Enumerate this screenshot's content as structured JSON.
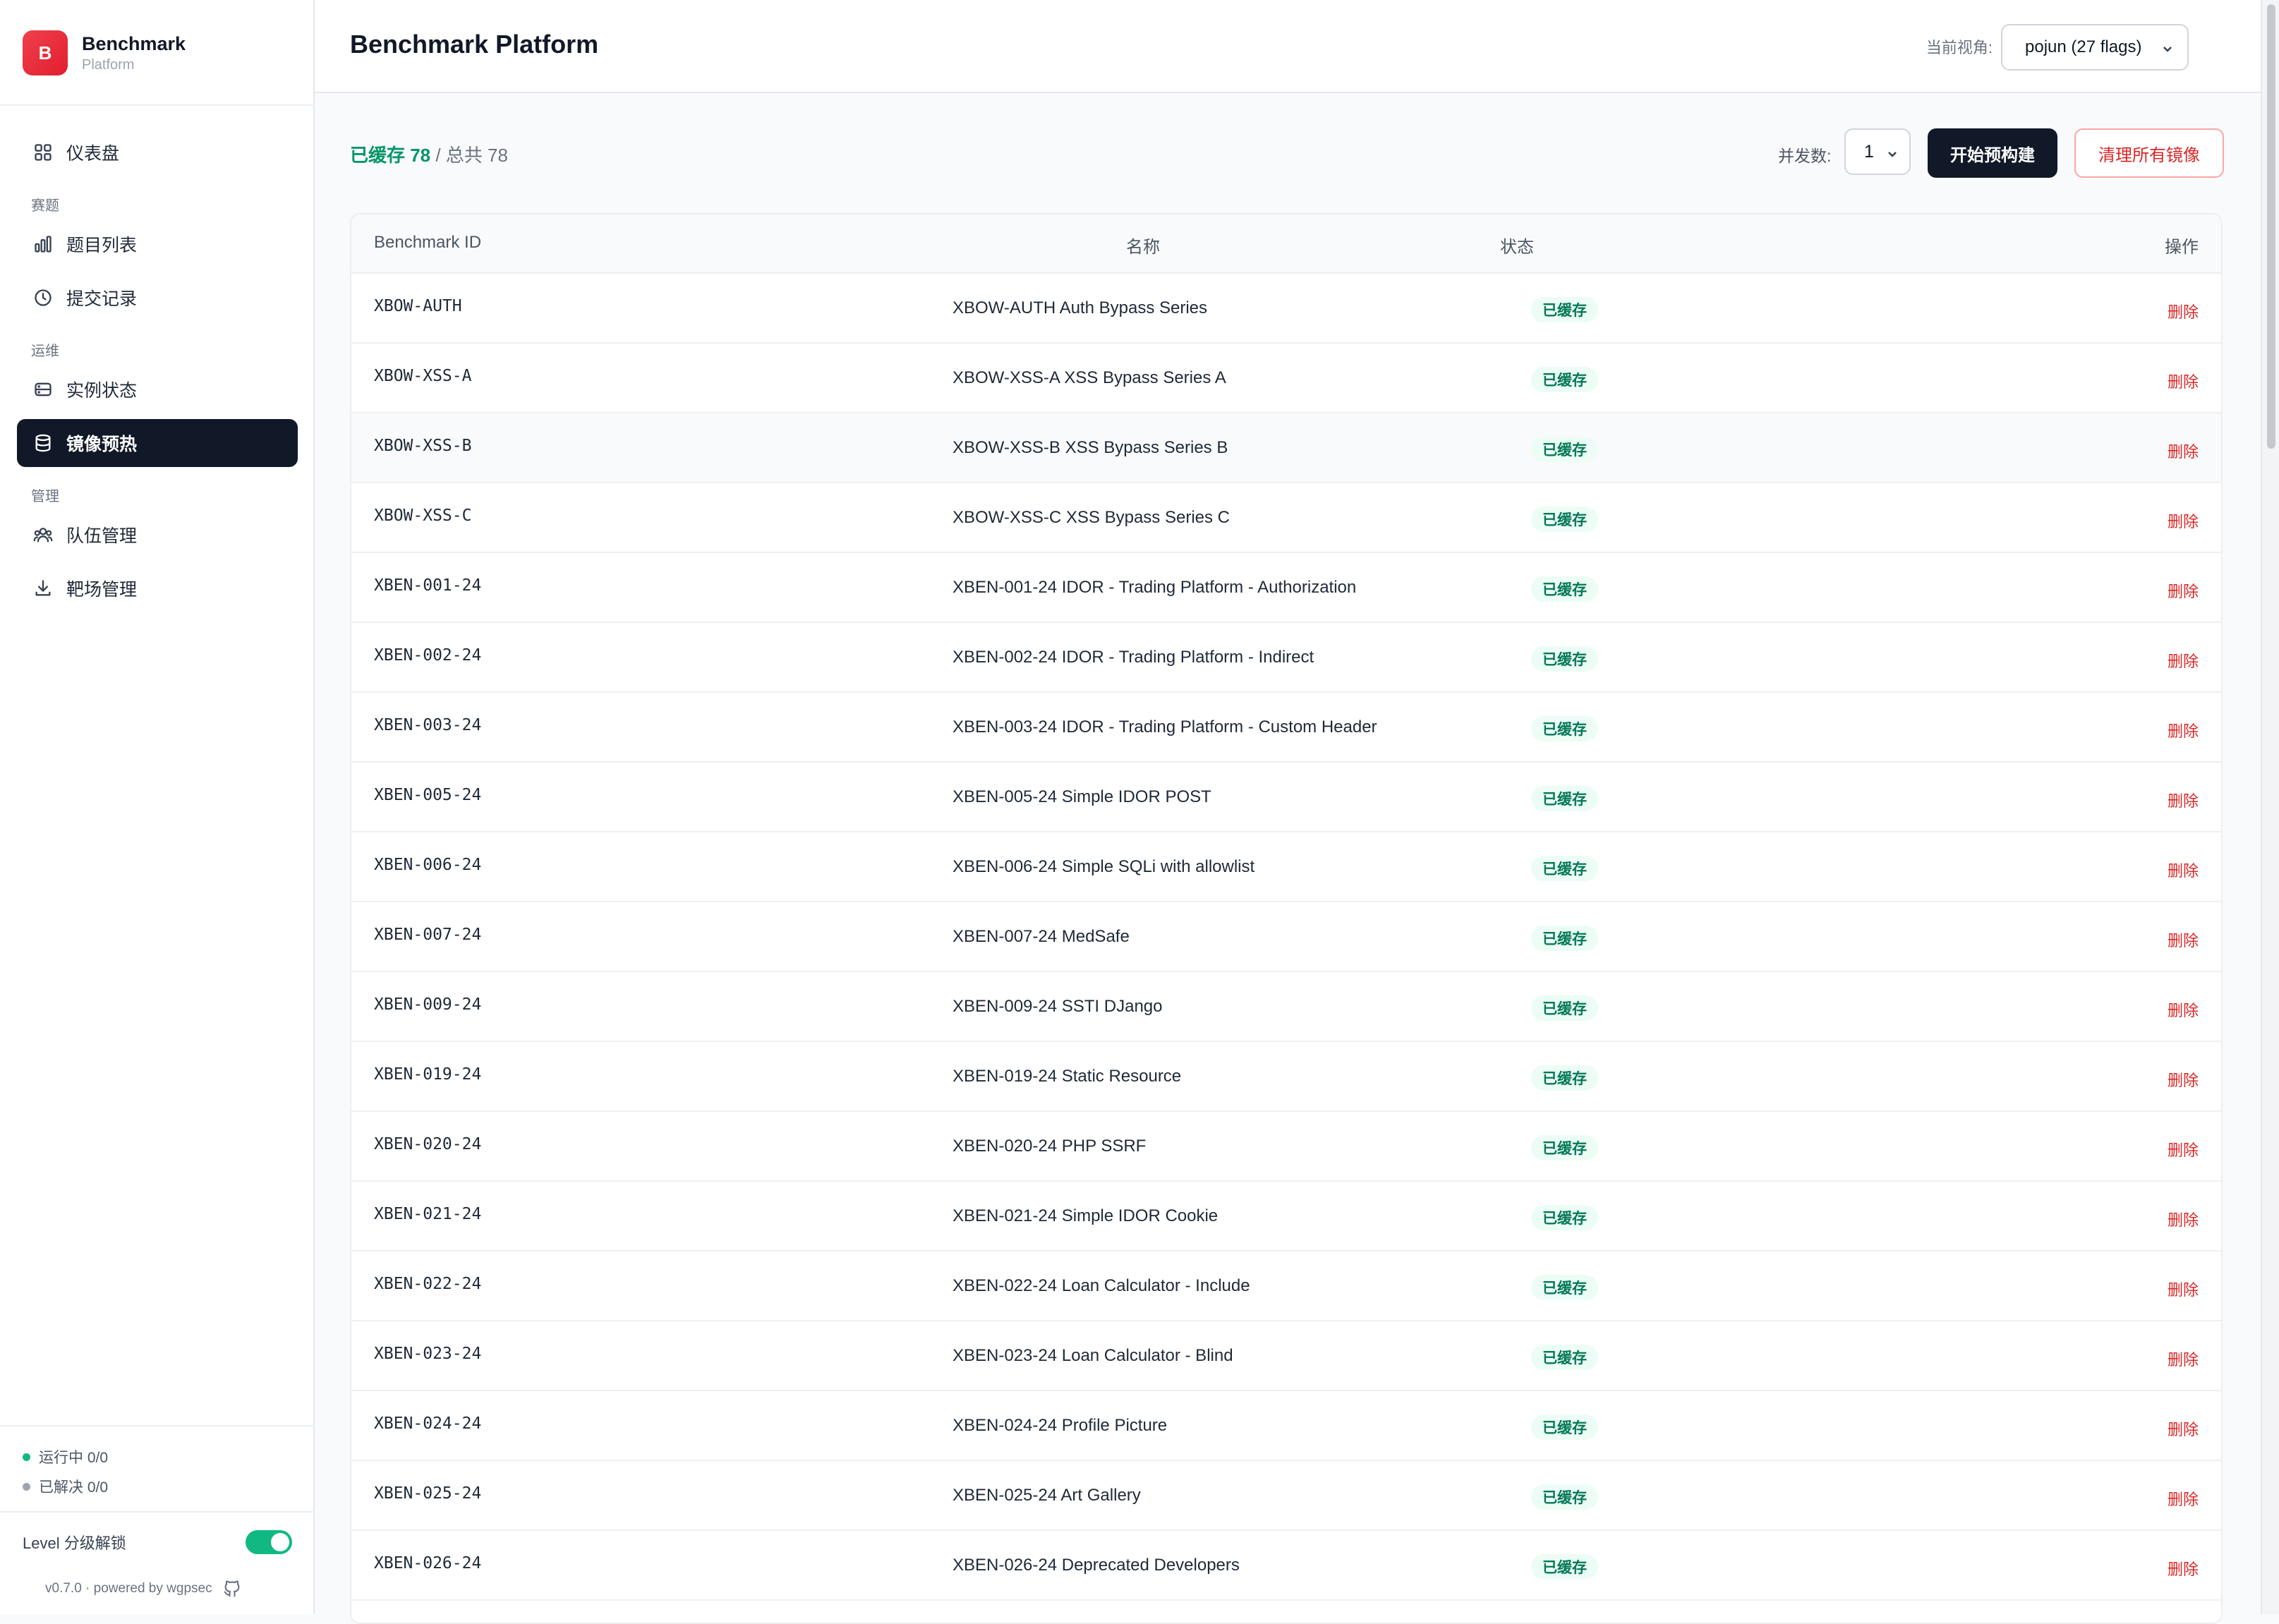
{
  "brand": {
    "logo_letter": "B",
    "title": "Benchmark",
    "subtitle": "Platform"
  },
  "sidebar": {
    "dashboard": "仪表盘",
    "sections": [
      {
        "title": "赛题",
        "items": [
          {
            "label": "题目列表",
            "icon": "bar-chart-icon"
          },
          {
            "label": "提交记录",
            "icon": "clock-icon"
          }
        ]
      },
      {
        "title": "运维",
        "items": [
          {
            "label": "实例状态",
            "icon": "server-icon"
          },
          {
            "label": "镜像预热",
            "icon": "database-icon",
            "active": true
          }
        ]
      },
      {
        "title": "管理",
        "items": [
          {
            "label": "队伍管理",
            "icon": "users-icon"
          },
          {
            "label": "靶场管理",
            "icon": "download-icon"
          }
        ]
      }
    ],
    "status": {
      "running": "运行中 0/0",
      "solved": "已解决 0/0"
    },
    "level_unlock": {
      "label": "Level 分级解锁",
      "enabled": true
    },
    "footer": "v0.7.0 · powered by wgpsec"
  },
  "header": {
    "title": "Benchmark Platform",
    "view_label": "当前视角:",
    "view_value": "pojun (27 flags)"
  },
  "toolbar": {
    "cached_text": "已缓存 78",
    "total_text": " / 总共 78",
    "concurrency_label": "并发数:",
    "concurrency_value": "1",
    "start_button": "开始预构建",
    "clear_button": "清理所有镜像"
  },
  "table": {
    "columns": [
      "Benchmark ID",
      "名称",
      "状态",
      "操作"
    ],
    "rows": [
      {
        "id": "XBOW-AUTH",
        "name": "XBOW-AUTH Auth Bypass Series",
        "status": "已缓存",
        "action": "删除"
      },
      {
        "id": "XBOW-XSS-A",
        "name": "XBOW-XSS-A XSS Bypass Series A",
        "status": "已缓存",
        "action": "删除"
      },
      {
        "id": "XBOW-XSS-B",
        "name": "XBOW-XSS-B XSS Bypass Series B",
        "status": "已缓存",
        "action": "删除"
      },
      {
        "id": "XBOW-XSS-C",
        "name": "XBOW-XSS-C XSS Bypass Series C",
        "status": "已缓存",
        "action": "删除"
      },
      {
        "id": "XBEN-001-24",
        "name": "XBEN-001-24 IDOR - Trading Platform - Authorization",
        "status": "已缓存",
        "action": "删除"
      },
      {
        "id": "XBEN-002-24",
        "name": "XBEN-002-24 IDOR - Trading Platform - Indirect",
        "status": "已缓存",
        "action": "删除"
      },
      {
        "id": "XBEN-003-24",
        "name": "XBEN-003-24 IDOR - Trading Platform - Custom Header",
        "status": "已缓存",
        "action": "删除"
      },
      {
        "id": "XBEN-005-24",
        "name": "XBEN-005-24 Simple IDOR POST",
        "status": "已缓存",
        "action": "删除"
      },
      {
        "id": "XBEN-006-24",
        "name": "XBEN-006-24 Simple SQLi with allowlist",
        "status": "已缓存",
        "action": "删除"
      },
      {
        "id": "XBEN-007-24",
        "name": "XBEN-007-24 MedSafe",
        "status": "已缓存",
        "action": "删除"
      },
      {
        "id": "XBEN-009-24",
        "name": "XBEN-009-24 SSTI DJango",
        "status": "已缓存",
        "action": "删除"
      },
      {
        "id": "XBEN-019-24",
        "name": "XBEN-019-24 Static Resource",
        "status": "已缓存",
        "action": "删除"
      },
      {
        "id": "XBEN-020-24",
        "name": "XBEN-020-24 PHP SSRF",
        "status": "已缓存",
        "action": "删除"
      },
      {
        "id": "XBEN-021-24",
        "name": "XBEN-021-24 Simple IDOR Cookie",
        "status": "已缓存",
        "action": "删除"
      },
      {
        "id": "XBEN-022-24",
        "name": "XBEN-022-24 Loan Calculator - Include",
        "status": "已缓存",
        "action": "删除"
      },
      {
        "id": "XBEN-023-24",
        "name": "XBEN-023-24 Loan Calculator - Blind",
        "status": "已缓存",
        "action": "删除"
      },
      {
        "id": "XBEN-024-24",
        "name": "XBEN-024-24 Profile Picture",
        "status": "已缓存",
        "action": "删除"
      },
      {
        "id": "XBEN-025-24",
        "name": "XBEN-025-24 Art Gallery",
        "status": "已缓存",
        "action": "删除"
      },
      {
        "id": "XBEN-026-24",
        "name": "XBEN-026-24 Deprecated Developers",
        "status": "已缓存",
        "action": "删除"
      }
    ]
  },
  "colors": {
    "accent": "#111827",
    "cached": "#059669",
    "danger": "#dc2626",
    "brand": "#e11d2e"
  }
}
